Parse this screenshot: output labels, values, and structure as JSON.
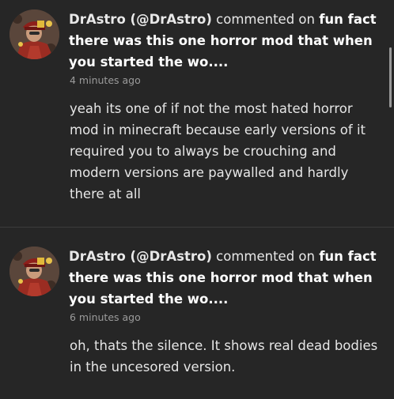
{
  "notifications": [
    {
      "author": "DrAstro (@DrAstro)",
      "verb": "commented on",
      "post_title": "fun fact there was this one horror mod that when you started the wo....",
      "timestamp": "4 minutes ago",
      "comment": "yeah its one of if not the most hated horror mod in minecraft because early versions of it required you to always be crouching and modern versions are paywalled and hardly there at all"
    },
    {
      "author": "DrAstro (@DrAstro)",
      "verb": "commented on",
      "post_title": "fun fact there was this one horror mod that when you started the wo....",
      "timestamp": "6 minutes ago",
      "comment": "oh, thats the silence. It shows real dead bodies in the uncesored version."
    }
  ],
  "colors": {
    "background": "#262626",
    "divider": "#3b3b3b",
    "timestamp": "#9b9b9b",
    "text": "#e6e6e6"
  }
}
